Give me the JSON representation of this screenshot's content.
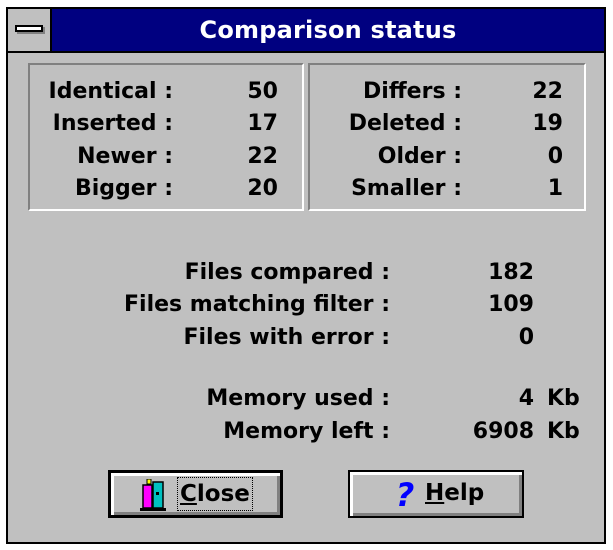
{
  "window": {
    "title": "Comparison status",
    "colors": {
      "face": "#c0c0c0",
      "titlebar": "#000080",
      "title_text": "#ffffff",
      "highlight": "#ffffff",
      "shadow": "#808080"
    }
  },
  "left_stats": [
    {
      "label": "Identical :",
      "value": "50"
    },
    {
      "label": "Inserted :",
      "value": "17"
    },
    {
      "label": "Newer :",
      "value": "22"
    },
    {
      "label": "Bigger :",
      "value": "20"
    }
  ],
  "right_stats": [
    {
      "label": "Differs :",
      "value": "22"
    },
    {
      "label": "Deleted :",
      "value": "19"
    },
    {
      "label": "Older :",
      "value": "0"
    },
    {
      "label": "Smaller :",
      "value": "1"
    }
  ],
  "summary": {
    "files_compared": {
      "label": "Files compared :",
      "value": "182"
    },
    "files_matching": {
      "label": "Files matching filter :",
      "value": "109"
    },
    "files_error": {
      "label": "Files with error :",
      "value": "0"
    },
    "memory_used": {
      "label": "Memory used :",
      "value": "4",
      "unit": "Kb"
    },
    "memory_left": {
      "label": "Memory left :",
      "value": "6908",
      "unit": "Kb"
    }
  },
  "buttons": {
    "close": {
      "mnemonic": "C",
      "rest": "lose",
      "icon": "close-door-icon"
    },
    "help": {
      "mnemonic": "H",
      "rest": "elp",
      "icon": "question-mark-icon",
      "icon_color": "#0000ff"
    }
  }
}
